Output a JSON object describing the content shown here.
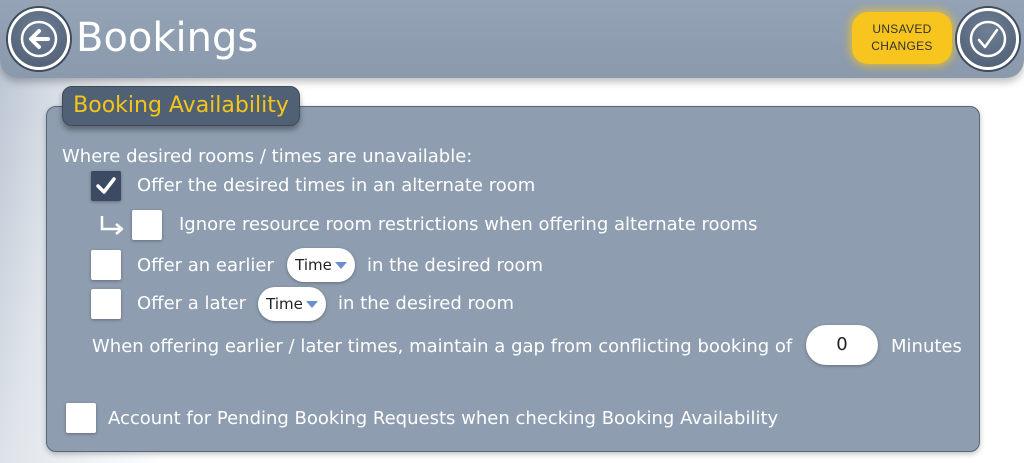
{
  "header": {
    "title": "Bookings",
    "unsaved_line1": "UNSAVED",
    "unsaved_line2": "CHANGES",
    "back_icon": "arrow-left-circle-icon",
    "confirm_icon": "checkmark-circle-icon"
  },
  "panel": {
    "title": "Booking Availability",
    "intro": "Where desired rooms / times are unavailable:",
    "options": [
      {
        "label": "Offer the desired times in an alternate room",
        "checked": true
      },
      {
        "label": "Ignore resource room restrictions when offering alternate rooms",
        "checked": false
      },
      {
        "label_before": "Offer an earlier",
        "dropdown": "Time",
        "label_after": "in the desired room",
        "checked": false
      },
      {
        "label_before": "Offer a later",
        "dropdown": "Time",
        "label_after": "in the desired room",
        "checked": false
      }
    ],
    "gap_label": "When offering earlier / later times, maintain a gap from conflicting booking of",
    "gap_value": "0",
    "gap_unit": "Minutes",
    "pending": {
      "label": "Account for Pending Booking Requests when checking Booking Availability",
      "checked": false
    }
  },
  "colors": {
    "accent": "#f5c518",
    "unsaved_badge": "#f7c51e",
    "panel_bg": "#8e9db0",
    "header_bg": "#8a99ab",
    "checkbox_checked": "#3c4a64"
  }
}
